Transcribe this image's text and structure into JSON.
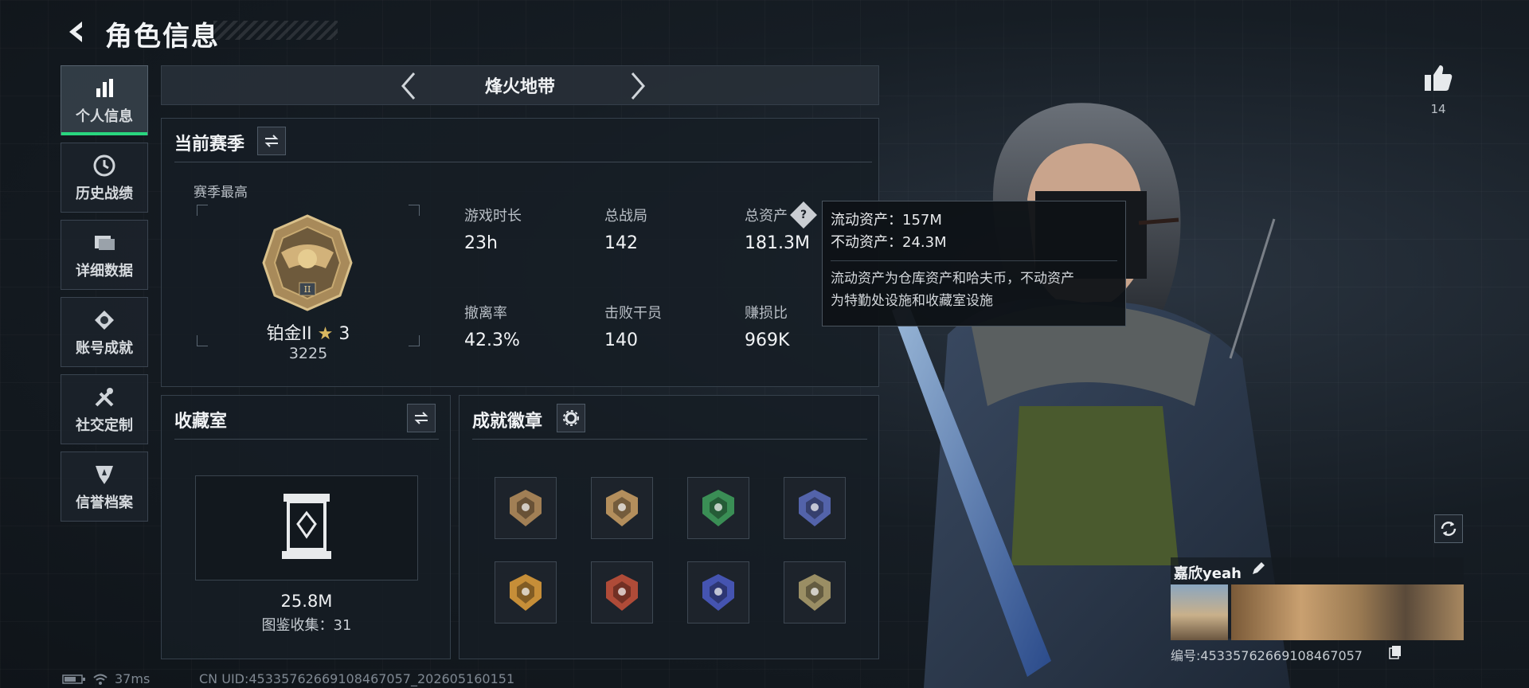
{
  "header": {
    "title": "角色信息"
  },
  "nav": {
    "items": [
      {
        "label": "个人信息",
        "icon": "bar-chart-icon",
        "active": true
      },
      {
        "label": "历史战绩",
        "icon": "clock-icon"
      },
      {
        "label": "详细数据",
        "icon": "folder-icon"
      },
      {
        "label": "账号成就",
        "icon": "medal-icon"
      },
      {
        "label": "社交定制",
        "icon": "tools-icon"
      },
      {
        "label": "信誉档案",
        "icon": "shield-icon"
      }
    ]
  },
  "mode_tab": {
    "title": "烽火地带"
  },
  "season": {
    "title": "当前赛季",
    "best_label": "赛季最高",
    "rank_name": "铂金II",
    "rank_stars": "3",
    "rank_points": "3225",
    "stats": [
      {
        "label": "游戏时长",
        "value": "23h"
      },
      {
        "label": "总战局",
        "value": "142"
      },
      {
        "label": "总资产",
        "value": "181.3M"
      },
      {
        "label": "撤离率",
        "value": "42.3%"
      },
      {
        "label": "击败干员",
        "value": "140"
      },
      {
        "label": "赚损比",
        "value": "969K"
      }
    ]
  },
  "tooltip": {
    "liquid": "流动资产：157M",
    "fixed": "不动资产：24.3M",
    "desc_line1": "流动资产为仓库资产和哈夫币，不动资产",
    "desc_line2": "为特勤处设施和收藏室设施"
  },
  "collection": {
    "title": "收藏室",
    "value": "25.8M",
    "count_label": "图鉴收集：31"
  },
  "achievements": {
    "title": "成就徽章",
    "badges": [
      {
        "icon": "helicopter-badge-icon",
        "color": "#b08a5a"
      },
      {
        "icon": "lion-badge-icon",
        "color": "#c49a62"
      },
      {
        "icon": "green-emblem-badge-icon",
        "color": "#3e9a5a"
      },
      {
        "icon": "star-badge-icon",
        "color": "#5a6ab8"
      },
      {
        "icon": "soldiers-badge-icon",
        "color": "#d99a3a"
      },
      {
        "icon": "dragon-badge-icon",
        "color": "#c0503a"
      },
      {
        "icon": "globe-badge-icon",
        "color": "#4a5ac0"
      },
      {
        "icon": "triangle-badge-icon",
        "color": "#a89a6a"
      }
    ]
  },
  "profile": {
    "likes": "14",
    "player_name": "嘉欣yeah",
    "player_id": "编号:4533576266910846​7057"
  },
  "footer": {
    "ping": "37ms",
    "uid": "CN UID:4533576266910846​7057_202605160151"
  }
}
